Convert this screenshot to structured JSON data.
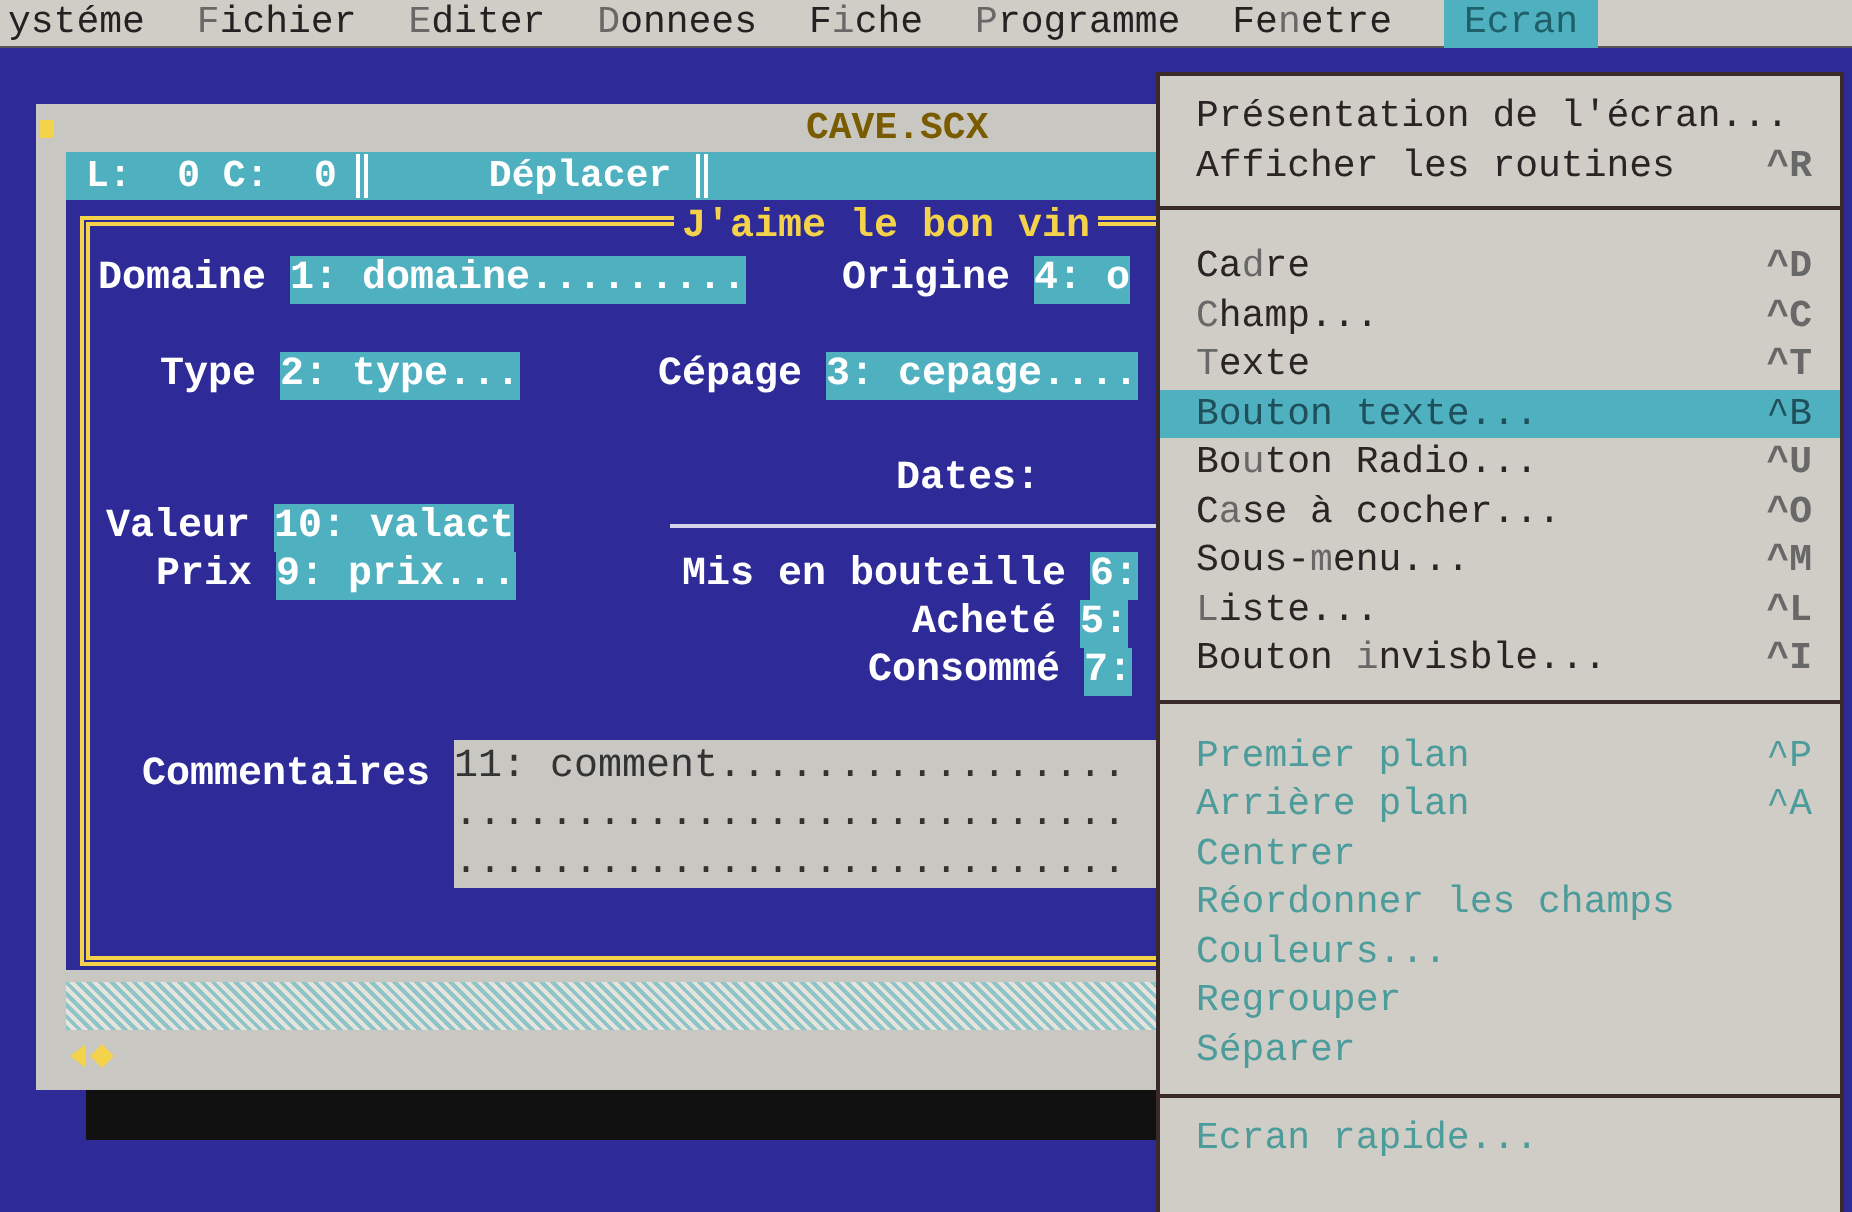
{
  "menu_bar": [
    {
      "post": "ystéme",
      "selected": false
    },
    {
      "key": "F",
      "post": "ichier",
      "selected": false
    },
    {
      "key": "E",
      "post": "diter",
      "selected": false
    },
    {
      "key": "D",
      "post": "onnees",
      "selected": false
    },
    {
      "pre": "F",
      "key": "i",
      "post": "che",
      "selected": false
    },
    {
      "key": "P",
      "post": "rogramme",
      "selected": false
    },
    {
      "pre": "Fe",
      "key": "n",
      "post": "etre",
      "selected": false
    },
    {
      "pre": "Ecran",
      "selected": true
    }
  ],
  "window": {
    "title": "CAVE.SCX",
    "status": {
      "position": "L:  0 C:  0",
      "mode": "Déplacer"
    },
    "form": {
      "title": "J'aime le bon vin",
      "items": [
        {
          "label": "Domaine",
          "field": "1: domaine........."
        },
        {
          "label": "Origine",
          "field": "4: o"
        },
        {
          "label": "Type",
          "field": "2: type..."
        },
        {
          "label": "Cépage",
          "field": "3: cepage...."
        },
        {
          "label": "Dates:"
        },
        {
          "label": "Valeur",
          "field": "10: valact"
        },
        {
          "label": "Prix",
          "field": "9: prix..."
        },
        {
          "label": "Mis en bouteille",
          "field": "6:"
        },
        {
          "label": "Acheté",
          "field": "5:"
        },
        {
          "label": "Consommé",
          "field": "7:"
        },
        {
          "label": "Commentaires",
          "lines": [
            "11: comment.................",
            "............................",
            "............................"
          ]
        }
      ]
    }
  },
  "dropdown": {
    "sections": [
      [
        {
          "pre": "Présentation de l'écran...",
          "disabled": false,
          "selected": false
        },
        {
          "pre": "Afficher les routines",
          "shortcut": "^R",
          "disabled": false,
          "selected": false
        }
      ],
      [
        {
          "pre": "Ca",
          "key": "d",
          "post": "re",
          "shortcut": "^D",
          "disabled": false,
          "selected": false
        },
        {
          "key": "C",
          "post": "hamp...",
          "shortcut": "^C",
          "disabled": false,
          "selected": false
        },
        {
          "key": "T",
          "post": "exte",
          "shortcut": "^T",
          "disabled": false,
          "selected": false
        },
        {
          "pre": "Bouton texte...",
          "shortcut": "^B",
          "disabled": false,
          "selected": true
        },
        {
          "pre": "Bo",
          "key": "u",
          "post": "ton Radio...",
          "shortcut": "^U",
          "disabled": false,
          "selected": false
        },
        {
          "pre": "C",
          "key": "a",
          "post": "se à cocher...",
          "shortcut": "^O",
          "disabled": false,
          "selected": false
        },
        {
          "pre": "Sous-",
          "key": "m",
          "post": "enu...",
          "shortcut": "^M",
          "disabled": false,
          "selected": false
        },
        {
          "key": "L",
          "post": "iste...",
          "shortcut": "^L",
          "disabled": false,
          "selected": false
        },
        {
          "pre": "Bouton ",
          "key": "i",
          "post": "nvisble...",
          "shortcut": "^I",
          "disabled": false,
          "selected": false
        }
      ],
      [
        {
          "pre": "Premier plan",
          "shortcut": "^P",
          "disabled": true,
          "selected": false
        },
        {
          "pre": "Arrière plan",
          "shortcut": "^A",
          "disabled": true,
          "selected": false
        },
        {
          "pre": "Centrer",
          "disabled": true,
          "selected": false
        },
        {
          "pre": "Réordonner les champs",
          "disabled": true,
          "selected": false
        },
        {
          "pre": "Couleurs...",
          "disabled": true,
          "selected": false
        },
        {
          "pre": "Regrouper",
          "disabled": true,
          "selected": false
        },
        {
          "pre": "Séparer",
          "disabled": true,
          "selected": false
        }
      ],
      [
        {
          "pre": "Ecran rapide...",
          "disabled": true,
          "selected": false
        }
      ]
    ]
  }
}
